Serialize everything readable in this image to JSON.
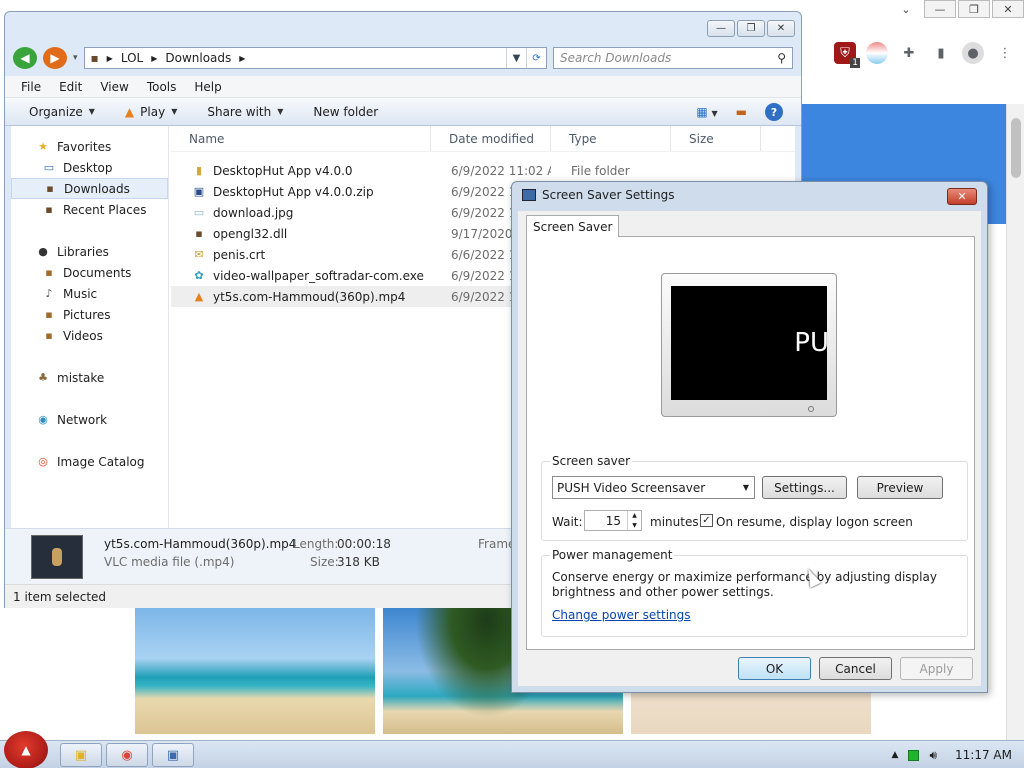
{
  "browser": {
    "window_controls": [
      "⌄",
      "—",
      "❐",
      "✕"
    ],
    "extension_badge": "1"
  },
  "explorer": {
    "window_controls": [
      "—",
      "❐",
      "✕"
    ],
    "breadcrumb": [
      "LOL",
      "Downloads"
    ],
    "search_placeholder": "Search Downloads",
    "menu": [
      "File",
      "Edit",
      "View",
      "Tools",
      "Help"
    ],
    "commands": {
      "organize": "Organize",
      "play": "Play",
      "share_with": "Share with",
      "new_folder": "New folder"
    },
    "nav": {
      "favorites": "Favorites",
      "desktop": "Desktop",
      "downloads": "Downloads",
      "recent_places": "Recent Places",
      "libraries": "Libraries",
      "documents": "Documents",
      "music": "Music",
      "pictures": "Pictures",
      "videos": "Videos",
      "mistake": "mistake",
      "network": "Network",
      "image_catalog": "Image Catalog"
    },
    "columns": [
      "Name",
      "Date modified",
      "Type",
      "Size"
    ],
    "files": [
      {
        "name": "DesktopHut App v4.0.0",
        "date": "6/9/2022 11:02 AM",
        "type": "File folder"
      },
      {
        "name": "DesktopHut App v4.0.0.zip",
        "date": "6/9/2022 11",
        "type": ""
      },
      {
        "name": "download.jpg",
        "date": "6/9/2022 10",
        "type": ""
      },
      {
        "name": "opengl32.dll",
        "date": "9/17/2020 2",
        "type": ""
      },
      {
        "name": "penis.crt",
        "date": "6/6/2022 11",
        "type": ""
      },
      {
        "name": "video-wallpaper_softradar-com.exe",
        "date": "6/9/2022 11",
        "type": ""
      },
      {
        "name": "yt5s.com-Hammoud(360p).mp4",
        "date": "6/9/2022 10",
        "type": ""
      }
    ],
    "details": {
      "name": "yt5s.com-Hammoud(360p).mp4",
      "type": "VLC media file (.mp4)",
      "length_label": "Length:",
      "length": "00:00:18",
      "size_label": "Size:",
      "size": "318 KB",
      "frame_label": "Frame"
    },
    "status": "1 item selected"
  },
  "screensaver": {
    "title": "Screen Saver Settings",
    "tab": "Screen Saver",
    "preview_text": "PU",
    "group_screensaver": "Screen saver",
    "selected": "PUSH Video Screensaver",
    "settings_button": "Settings...",
    "preview_button": "Preview",
    "wait_label": "Wait:",
    "wait_value": "15",
    "minutes_label": "minutes",
    "logon_checked": true,
    "logon_label": "On resume, display logon screen",
    "group_power": "Power management",
    "power_text": "Conserve energy or maximize performance by adjusting display brightness and other power settings.",
    "power_link": "Change power settings",
    "ok": "OK",
    "cancel": "Cancel",
    "apply": "Apply"
  },
  "taskbar": {
    "time": "11:17 AM"
  }
}
